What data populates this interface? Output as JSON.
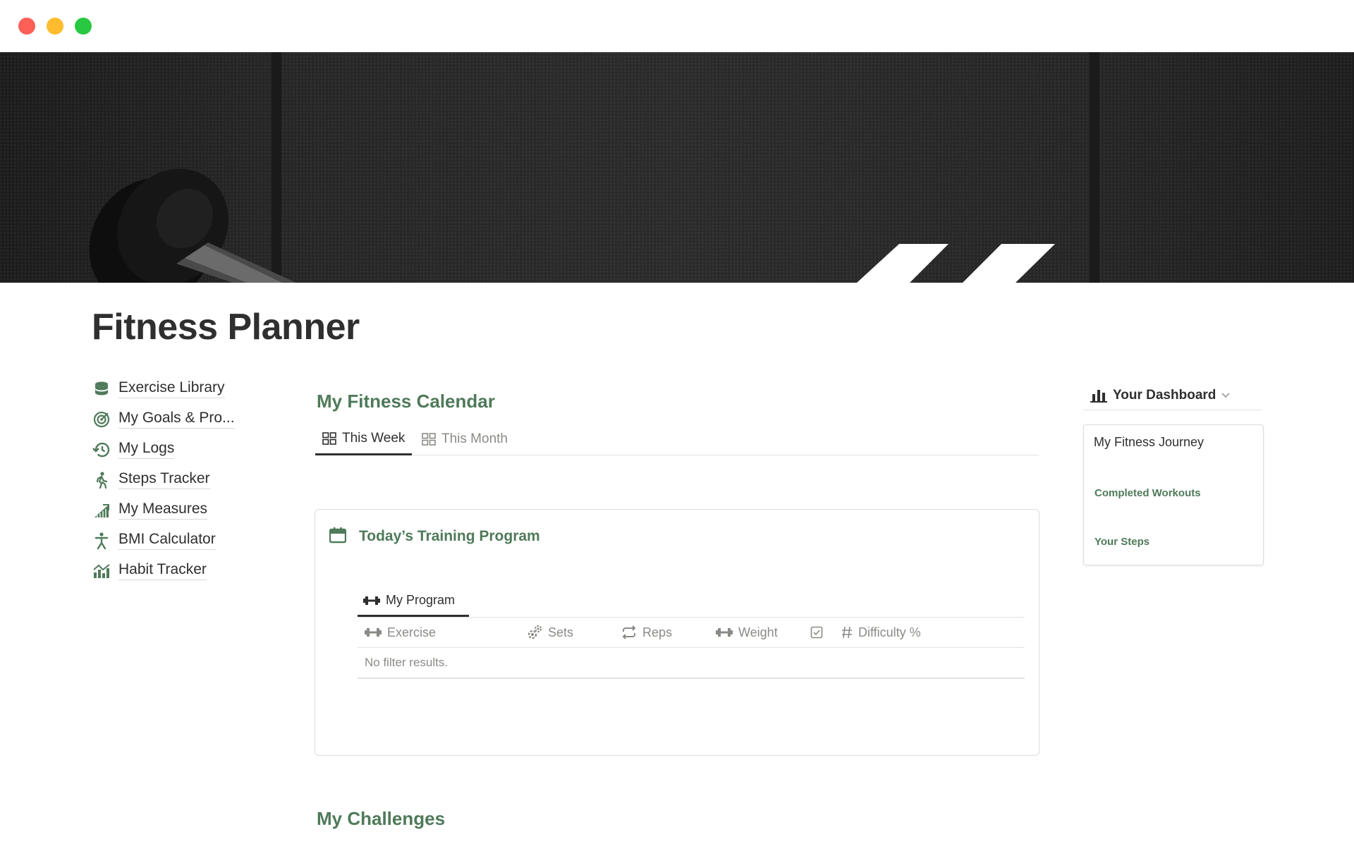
{
  "page": {
    "title": "Fitness Planner"
  },
  "nav": {
    "items": [
      {
        "label": "Exercise Library",
        "icon": "database-icon"
      },
      {
        "label": "My Goals & Pro...",
        "icon": "target-icon"
      },
      {
        "label": "My Logs",
        "icon": "history-icon"
      },
      {
        "label": "Steps Tracker",
        "icon": "walking-icon"
      },
      {
        "label": "My Measures",
        "icon": "chart-up-icon"
      },
      {
        "label": "BMI Calculator",
        "icon": "person-icon"
      },
      {
        "label": "Habit Tracker",
        "icon": "bar-trend-icon"
      }
    ]
  },
  "calendar": {
    "title": "My Fitness Calendar",
    "tabs": [
      {
        "label": "This Week",
        "active": true
      },
      {
        "label": "This Month",
        "active": false
      }
    ]
  },
  "training": {
    "title": "Today’s Training Program",
    "view_tab": "My Program",
    "columns": [
      "Exercise",
      "Sets",
      "Reps",
      "Weight",
      "",
      "Difficulty %"
    ],
    "empty_text": "No filter results."
  },
  "challenges": {
    "title": "My Challenges"
  },
  "dashboard": {
    "label": "Your Dashboard",
    "card_title": "My Fitness Journey",
    "links": [
      "Completed Workouts",
      "Your Steps"
    ]
  },
  "colors": {
    "accent_green": "#4f7a5a",
    "text": "#2f2f2f",
    "muted": "#8a8a86"
  }
}
